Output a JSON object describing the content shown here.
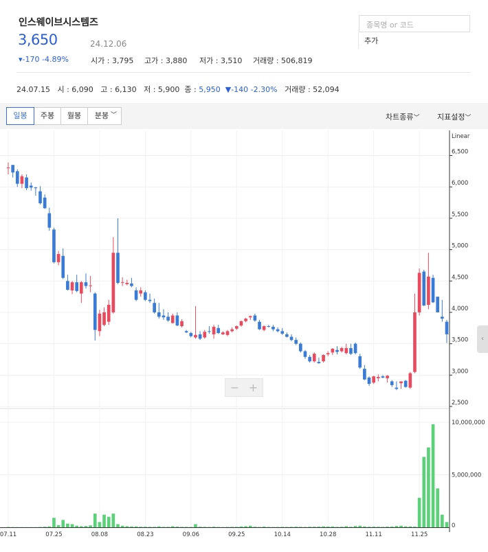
{
  "stock": {
    "name": "인스웨이브시스템즈",
    "price": "3,650",
    "date": "24.12.06",
    "change": "▾-170 -4.89%",
    "open": "시가 : 3,795",
    "high": "고가 : 3,880",
    "low": "저가 : 3,510",
    "volume": "거래량 : 506,819"
  },
  "search": {
    "placeholder": "종목명 or 코드",
    "add_label": "추가"
  },
  "prev": {
    "date": "24.07.15",
    "open": "시 : 6,090",
    "high": "고 : 6,130",
    "low": "저 : 5,900",
    "close_label": "종 : ",
    "close": "5,950",
    "change": "▼-140 -2.30%",
    "volume": "거래량 : 52,094"
  },
  "toolbar": {
    "tabs": [
      "일봉",
      "주봉",
      "월봉",
      "분봉"
    ],
    "chart_type": "차트종류",
    "indicator": "지표설정"
  },
  "colors": {
    "up": "#e84a5f",
    "down": "#3a7bd5",
    "volume": "#5cd17a",
    "accent": "#2b5fd9"
  },
  "chart_data": {
    "type": "candlestick",
    "scale_label": "Linear",
    "x_tick_labels": [
      "07.11",
      "07.25",
      "08.08",
      "08.23",
      "09.06",
      "09.25",
      "10.14",
      "10.28",
      "11.11",
      "11.25"
    ],
    "price_ticks": [
      "6,500",
      "6,000",
      "5,500",
      "5,000",
      "4,500",
      "4,000",
      "3,500",
      "3,000",
      "2,500"
    ],
    "price_tick_values": [
      6500,
      6000,
      5500,
      5000,
      4500,
      4000,
      3500,
      3000,
      2500
    ],
    "volume_ticks": [
      "10,000,000",
      "5,000,000",
      "0"
    ],
    "volume_tick_values": [
      10000000,
      5000000,
      0
    ],
    "ylim": [
      2500,
      6900
    ],
    "vol_max": 11500000,
    "candles": [
      [
        6300,
        6390,
        6200,
        6310
      ],
      [
        6350,
        6350,
        6150,
        6230
      ],
      [
        6250,
        6280,
        6000,
        6050
      ],
      [
        6050,
        6200,
        5980,
        6170
      ],
      [
        6150,
        6200,
        5950,
        5980
      ],
      [
        6020,
        6070,
        5940,
        5990
      ],
      [
        5990,
        6000,
        5860,
        5980
      ],
      [
        5930,
        6010,
        5720,
        5740
      ],
      [
        5830,
        5880,
        5650,
        5660
      ],
      [
        5580,
        5670,
        5300,
        5350
      ],
      [
        5320,
        5350,
        4780,
        4800
      ],
      [
        4800,
        4980,
        4750,
        4930
      ],
      [
        4900,
        5020,
        4530,
        4550
      ],
      [
        4500,
        4600,
        4350,
        4360
      ],
      [
        4350,
        4500,
        4290,
        4480
      ],
      [
        4480,
        4600,
        4320,
        4340
      ],
      [
        4300,
        4500,
        4150,
        4480
      ],
      [
        4480,
        4620,
        4380,
        4420
      ],
      [
        4420,
        4580,
        4320,
        4430
      ],
      [
        4300,
        4320,
        3550,
        3720
      ],
      [
        3700,
        4040,
        3620,
        3980
      ],
      [
        3800,
        4080,
        3780,
        4000
      ],
      [
        3850,
        4200,
        3800,
        4120
      ],
      [
        4000,
        5200,
        3980,
        4950
      ],
      [
        4950,
        5500,
        4450,
        4470
      ],
      [
        4470,
        4560,
        4420,
        4480
      ],
      [
        4450,
        4520,
        4430,
        4470
      ],
      [
        4460,
        4550,
        4400,
        4420
      ],
      [
        4350,
        4400,
        4180,
        4200
      ],
      [
        4300,
        4400,
        4250,
        4350
      ],
      [
        4320,
        4350,
        4180,
        4200
      ],
      [
        4200,
        4300,
        4150,
        4180
      ],
      [
        4150,
        4220,
        3980,
        4000
      ],
      [
        4000,
        4150,
        3900,
        3930
      ],
      [
        3950,
        4050,
        3880,
        3920
      ],
      [
        3930,
        4000,
        3850,
        3870
      ],
      [
        3830,
        3980,
        3820,
        3950
      ],
      [
        3950,
        4000,
        3780,
        3790
      ],
      [
        3780,
        3890,
        3760,
        3860
      ],
      [
        3700,
        3720,
        3670,
        3680
      ],
      [
        3670,
        3690,
        3600,
        3620
      ],
      [
        3600,
        4100,
        3580,
        3640
      ],
      [
        3650,
        3700,
        3560,
        3580
      ],
      [
        3600,
        3720,
        3580,
        3690
      ],
      [
        3700,
        3780,
        3660,
        3690
      ],
      [
        3650,
        3800,
        3580,
        3770
      ],
      [
        3750,
        3800,
        3660,
        3670
      ],
      [
        3650,
        3700,
        3640,
        3680
      ],
      [
        3640,
        3720,
        3620,
        3700
      ],
      [
        3700,
        3760,
        3680,
        3730
      ],
      [
        3740,
        3790,
        3720,
        3780
      ],
      [
        3790,
        3870,
        3770,
        3860
      ],
      [
        3860,
        3910,
        3840,
        3900
      ],
      [
        3920,
        3950,
        3880,
        3940
      ],
      [
        3950,
        3980,
        3850,
        3870
      ],
      [
        3850,
        3880,
        3720,
        3730
      ],
      [
        3720,
        3790,
        3700,
        3780
      ],
      [
        3780,
        3800,
        3760,
        3770
      ],
      [
        3770,
        3800,
        3700,
        3730
      ],
      [
        3730,
        3760,
        3680,
        3700
      ],
      [
        3700,
        3750,
        3640,
        3660
      ],
      [
        3650,
        3680,
        3600,
        3610
      ],
      [
        3610,
        3650,
        3540,
        3560
      ],
      [
        3560,
        3600,
        3480,
        3500
      ],
      [
        3500,
        3520,
        3360,
        3380
      ],
      [
        3380,
        3400,
        3260,
        3290
      ],
      [
        3290,
        3320,
        3200,
        3220
      ],
      [
        3220,
        3360,
        3200,
        3340
      ],
      [
        3210,
        3280,
        3180,
        3190
      ],
      [
        3220,
        3330,
        3200,
        3320
      ],
      [
        3330,
        3380,
        3300,
        3350
      ],
      [
        3360,
        3430,
        3320,
        3420
      ],
      [
        3400,
        3460,
        3330,
        3370
      ],
      [
        3380,
        3450,
        3360,
        3430
      ],
      [
        3350,
        3500,
        3330,
        3430
      ],
      [
        3430,
        3500,
        3320,
        3340
      ],
      [
        3500,
        3520,
        3330,
        3350
      ],
      [
        3300,
        3340,
        3100,
        3120
      ],
      [
        3100,
        3160,
        2920,
        2930
      ],
      [
        2960,
        2980,
        2830,
        2860
      ],
      [
        2880,
        2990,
        2860,
        2980
      ],
      [
        2950,
        3010,
        2900,
        2970
      ],
      [
        2980,
        3000,
        2950,
        2960
      ],
      [
        2950,
        3000,
        2880,
        2990
      ],
      [
        2900,
        2920,
        2810,
        2840
      ],
      [
        2800,
        2900,
        2760,
        2780
      ],
      [
        2870,
        2900,
        2780,
        2900
      ],
      [
        2910,
        2920,
        2800,
        2810
      ],
      [
        2800,
        3050,
        2780,
        3030
      ],
      [
        3050,
        4300,
        3030,
        4000
      ],
      [
        4000,
        4700,
        3950,
        4630
      ],
      [
        4650,
        4680,
        4100,
        4110
      ],
      [
        4120,
        4950,
        4050,
        4570
      ],
      [
        4550,
        4600,
        4150,
        4160
      ],
      [
        4250,
        4250,
        4000,
        4000
      ],
      [
        3930,
        4200,
        3850,
        3900
      ],
      [
        3850,
        3880,
        3510,
        3650
      ]
    ],
    "volumes": [
      30000,
      20000,
      15000,
      12000,
      10000,
      10000,
      12000,
      30000,
      50000,
      80000,
      900000,
      200000,
      700000,
      350000,
      300000,
      150000,
      100000,
      120000,
      180000,
      1300000,
      500000,
      1200000,
      1000000,
      1300000,
      300000,
      150000,
      100000,
      80000,
      80000,
      50000,
      50000,
      40000,
      40000,
      80000,
      40000,
      40000,
      100000,
      60000,
      40000,
      40000,
      30000,
      300000,
      50000,
      40000,
      30000,
      50000,
      30000,
      20000,
      30000,
      40000,
      40000,
      80000,
      100000,
      150000,
      50000,
      30000,
      60000,
      30000,
      25000,
      30000,
      40000,
      30000,
      40000,
      50000,
      40000,
      30000,
      50000,
      50000,
      60000,
      90000,
      70000,
      80000,
      40000,
      50000,
      100000,
      50000,
      120000,
      150000,
      80000,
      50000,
      60000,
      50000,
      40000,
      60000,
      70000,
      120000,
      150000,
      90000,
      80000,
      60000,
      2800000,
      6700000,
      7600000,
      9800000,
      3700000,
      1200000,
      500000,
      506819
    ]
  }
}
